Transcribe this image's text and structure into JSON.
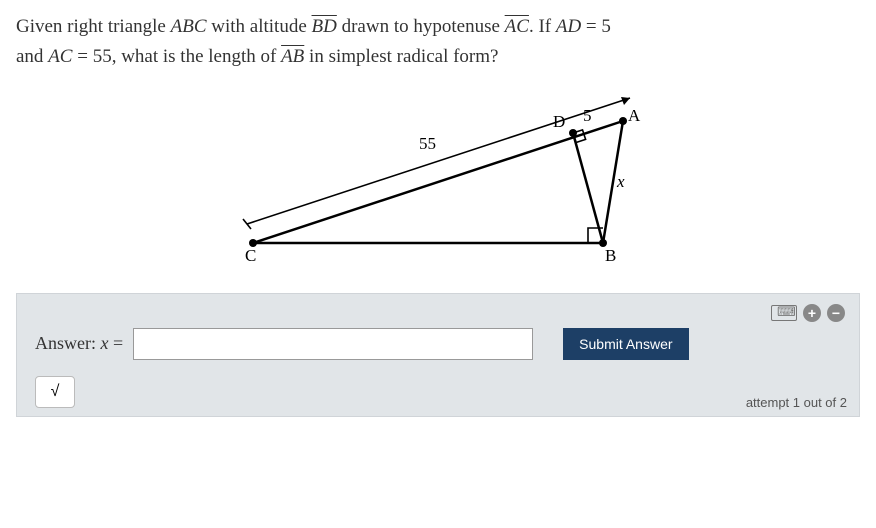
{
  "question": {
    "line1_prefix": "Given right triangle ",
    "triangle": "ABC",
    "line1_mid1": " with altitude ",
    "altitude": "BD",
    "line1_mid2": " drawn to hypotenuse ",
    "hypotenuse": "AC",
    "line1_mid3": ". If ",
    "given1_var": "AD",
    "given1_eq": " = ",
    "given1_val": "5",
    "line2_prefix": "and ",
    "given2_var": "AC",
    "given2_eq": " = ",
    "given2_val": "55",
    "line2_mid": ", what is the length of ",
    "target": "AB",
    "line2_suffix": " in simplest radical form?"
  },
  "diagram": {
    "label_A": "A",
    "label_B": "B",
    "label_C": "C",
    "label_D": "D",
    "label_55": "55",
    "label_5": "5",
    "label_x": "x"
  },
  "answer": {
    "label_prefix": "Answer:  ",
    "label_var": "x",
    "label_eq": " = ",
    "value": "",
    "placeholder": ""
  },
  "buttons": {
    "submit": "Submit Answer",
    "sqrt": "√"
  },
  "footer": {
    "attempt": "attempt 1 out of 2"
  },
  "icons": {
    "plus": "+",
    "minus": "−"
  }
}
